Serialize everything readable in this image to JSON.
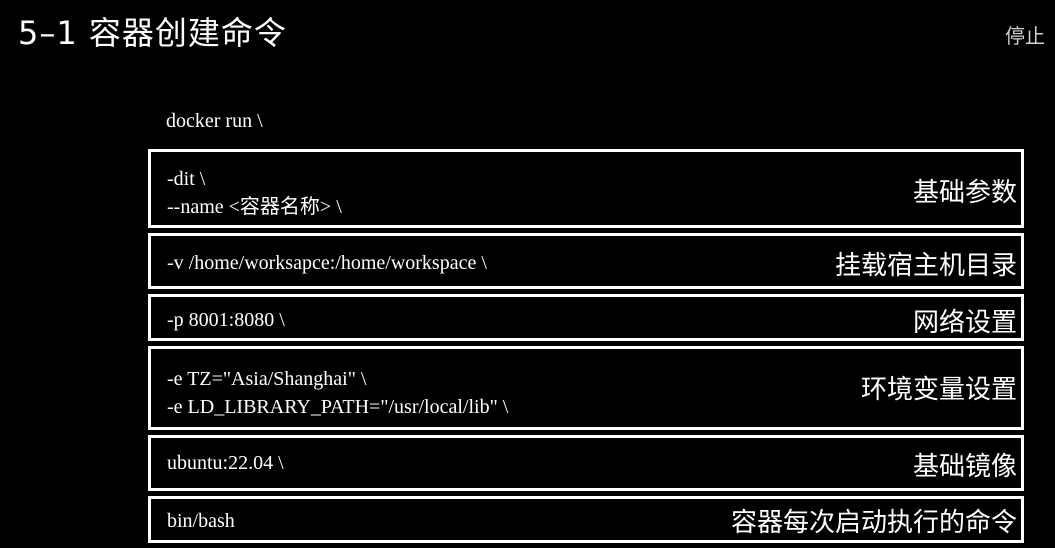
{
  "header": {
    "title": "5–1 容器创建命令",
    "stop_label": "停止"
  },
  "command": {
    "base": "docker run \\",
    "sections": [
      {
        "lines": [
          "-dit \\",
          "--name <容器名称> \\"
        ],
        "label": "基础参数"
      },
      {
        "lines": [
          "-v /home/worksapce:/home/workspace \\"
        ],
        "label": "挂载宿主机目录"
      },
      {
        "lines": [
          "-p 8001:8080 \\"
        ],
        "label": "网络设置"
      },
      {
        "lines": [
          "-e TZ=\"Asia/Shanghai\" \\",
          "-e LD_LIBRARY_PATH=\"/usr/local/lib\" \\"
        ],
        "label": "环境变量设置"
      },
      {
        "lines": [
          "ubuntu:22.04 \\"
        ],
        "label": "基础镜像"
      },
      {
        "lines": [
          "bin/bash"
        ],
        "label": "容器每次启动执行的命令"
      }
    ]
  },
  "colors": {
    "background": "#000000",
    "text": "#ffffff",
    "border": "#ffffff"
  }
}
